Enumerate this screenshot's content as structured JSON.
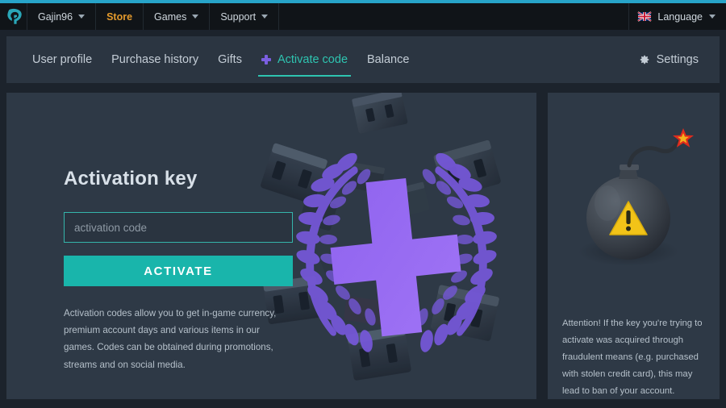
{
  "theme": {
    "accent_line": "#27a4c9",
    "panel_bg": "#2e3946",
    "page_bg": "#1c232c",
    "topbar_bg": "#101418",
    "navbar_bg": "#2b3541",
    "teal": "#19b5ab",
    "active_tab": "#2ec4b0",
    "purple": "#7b5fe0",
    "store_orange": "#e49a2c",
    "warning_yellow": "#f2c318",
    "spark_red": "#e02b1d"
  },
  "topbar": {
    "logo_icon": "gaijin-logo-icon",
    "items": [
      {
        "label": "Gajin96",
        "icon": "chevron-down-icon",
        "has_caret": true,
        "highlight": false
      },
      {
        "label": "Store",
        "has_caret": false,
        "highlight": true
      },
      {
        "label": "Games",
        "icon": "chevron-down-icon",
        "has_caret": true,
        "highlight": false
      },
      {
        "label": "Support",
        "icon": "chevron-down-icon",
        "has_caret": true,
        "highlight": false
      }
    ],
    "language": {
      "label": "Language",
      "flag_icon": "uk-flag-icon",
      "caret_icon": "chevron-down-icon"
    }
  },
  "nav": {
    "items": [
      {
        "label": "User profile",
        "active": false,
        "icon": null
      },
      {
        "label": "Purchase history",
        "active": false,
        "icon": null
      },
      {
        "label": "Gifts",
        "active": false,
        "icon": null
      },
      {
        "label": "Activate code",
        "active": true,
        "icon": "plus-icon"
      },
      {
        "label": "Balance",
        "active": false,
        "icon": null
      }
    ],
    "settings": {
      "label": "Settings",
      "icon": "gear-icon"
    }
  },
  "main": {
    "title": "Activation key",
    "input": {
      "placeholder": "activation code",
      "value": ""
    },
    "activate_button": "ACTIVATE",
    "description": "Activation codes allow you to get in-game currency, premium account days and various items in our games. Codes can be obtained during promotions, streams and on social media.",
    "illustration": "purple-plus-laurel-wreath-crates-art"
  },
  "sidebar": {
    "illustration": "bomb-warning-art",
    "warning": "Attention! If the key you're trying to activate was acquired through fraudulent means (e.g. purchased with stolen credit card), this may lead to ban of your account."
  }
}
